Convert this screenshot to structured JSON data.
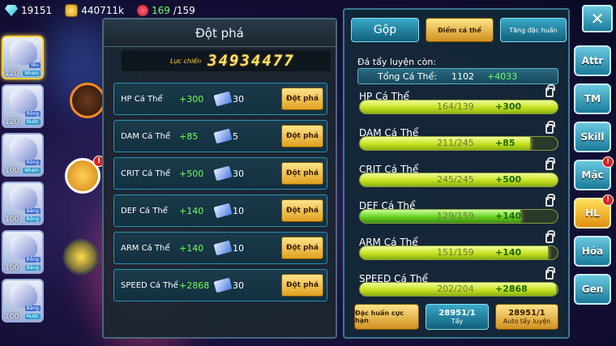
{
  "topbar": {
    "gems": "19151",
    "gold": "440711k",
    "stamina_current": "169",
    "stamina_sep_max": "/159"
  },
  "team": [
    {
      "level": "120",
      "tag1": "Yêu",
      "tag2": "Nham",
      "rank": "1"
    },
    {
      "level": "120",
      "tag1": "Rồng",
      "tag2": "Nước",
      "rank": "2"
    },
    {
      "level": "100",
      "tag1": "Rồng",
      "tag2": "Nham",
      "rank": "1"
    },
    {
      "level": "100",
      "tag1": "Băng",
      "tag2": "Rồng",
      "rank": "3"
    },
    {
      "level": "100",
      "tag1": "Rồng",
      "tag2": "Băng",
      "rank": "3"
    },
    {
      "level": "100",
      "tag1": "Băng",
      "tag2": "Nước",
      "rank": "2"
    }
  ],
  "left_panel": {
    "title": "Đột phá",
    "power_label": "Lực chiến",
    "power_value": "34934477",
    "rows": [
      {
        "name": "HP Cá Thể",
        "plus": "+300",
        "cost": "30",
        "button": "Đột phá"
      },
      {
        "name": "DAM Cá Thể",
        "plus": "+85",
        "cost": "5",
        "button": "Đột phá"
      },
      {
        "name": "CRIT Cá Thể",
        "plus": "+500",
        "cost": "30",
        "button": "Đột phá"
      },
      {
        "name": "DEF Cá Thể",
        "plus": "+140",
        "cost": "10",
        "button": "Đột phá"
      },
      {
        "name": "ARM Cá Thể",
        "plus": "+140",
        "cost": "10",
        "button": "Đột phá"
      },
      {
        "name": "SPEED Cá Thể",
        "plus": "+2868",
        "cost": "30",
        "button": "Đột phá"
      }
    ]
  },
  "right_panel": {
    "tab_gop": "Gộp",
    "tab_diem": "Điểm cá thể",
    "tab_tang": "Tăng đặc huấn",
    "remaining_label": "Đá tẩy luyện còn:",
    "total_label": "Tổng Cá Thể:",
    "total_value": "1102",
    "total_plus": "+4033",
    "stats": [
      {
        "name": "HP Cá Thể",
        "current": "164/139",
        "plus": "+300",
        "fill": 1.0
      },
      {
        "name": "DAM Cá Thể",
        "current": "211/245",
        "plus": "+85",
        "fill": 0.86
      },
      {
        "name": "CRIT Cá Thể",
        "current": "245/245",
        "plus": "+500",
        "fill": 1.0
      },
      {
        "name": "DEF Cá Thể",
        "current": "129/159",
        "plus": "+140",
        "fill": 0.81
      },
      {
        "name": "ARM Cá Thể",
        "current": "151/159",
        "plus": "+140",
        "fill": 0.95
      },
      {
        "name": "SPEED Cá Thể",
        "current": "202/204",
        "plus": "+2868",
        "fill": 0.99
      }
    ],
    "btn_training": "Đặc huấn cực hạn",
    "btn_tay_count": "28951/1",
    "btn_tay_label": "Tẩy",
    "btn_auto_count": "28951/1",
    "btn_auto_label": "Auto tẩy luyện"
  },
  "side_menu": {
    "close_label": "✕",
    "attr": "Attr",
    "tm": "TM",
    "skill": "Skill",
    "mac": "Mặc",
    "hl": "HL",
    "hoa": "Hóa",
    "gen": "Gen"
  },
  "colors": {
    "accent_green": "#6dff5a",
    "gold": "#ffd23a",
    "panel_border": "#3a7a90"
  }
}
